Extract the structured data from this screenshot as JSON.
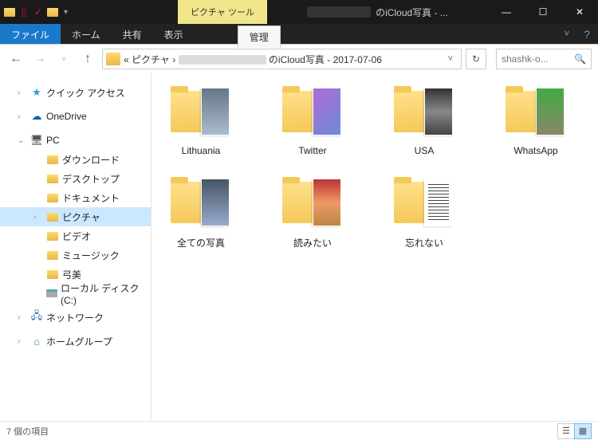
{
  "titlebar": {
    "tool_tab": "ピクチャ ツール",
    "title_suffix": "のiCloud写真 - ..."
  },
  "ribbon": {
    "file": "ファイル",
    "home": "ホーム",
    "share": "共有",
    "view": "表示",
    "manage": "管理"
  },
  "addressbar": {
    "prefix": "« ピクチャ ›",
    "suffix": "のiCloud写真 - 2017-07-06"
  },
  "search": {
    "placeholder": "shashk-o..."
  },
  "sidebar": {
    "quick_access": "クイック アクセス",
    "onedrive": "OneDrive",
    "pc": "PC",
    "downloads": "ダウンロード",
    "desktop": "デスクトップ",
    "documents": "ドキュメント",
    "pictures": "ピクチャ",
    "videos": "ビデオ",
    "music": "ミュージック",
    "user": "弓美",
    "local_disk": "ローカル ディスク (C:)",
    "network": "ネットワーク",
    "homegroup": "ホームグループ"
  },
  "folders": [
    {
      "label": "Lithuania",
      "thumb": "fp-1"
    },
    {
      "label": "Twitter",
      "thumb": "fp-2"
    },
    {
      "label": "USA",
      "thumb": "fp-3"
    },
    {
      "label": "WhatsApp",
      "thumb": "fp-4"
    },
    {
      "label": "全ての写真",
      "thumb": "fp-5"
    },
    {
      "label": "読みたい",
      "thumb": "fp-6"
    },
    {
      "label": "忘れない",
      "thumb": "fp-7"
    }
  ],
  "status": {
    "count": "7 個の項目"
  }
}
